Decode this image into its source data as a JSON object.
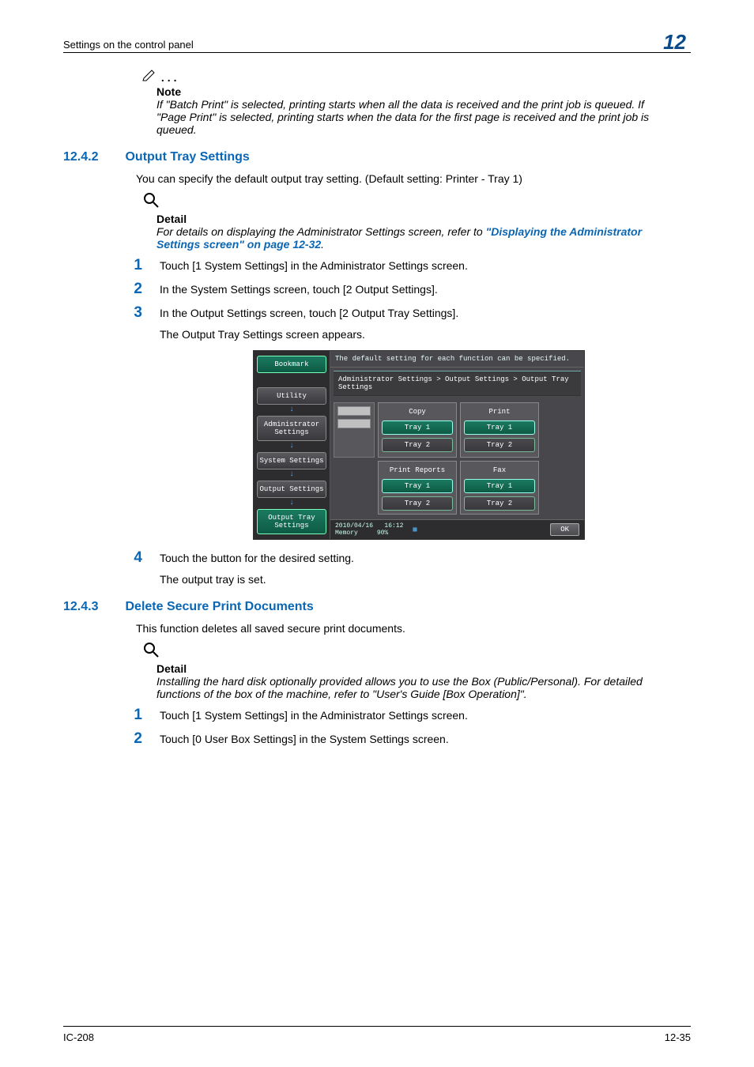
{
  "header": {
    "left": "Settings on the control panel",
    "chapter": "12"
  },
  "note1": {
    "label": "Note",
    "text": "If \"Batch Print\" is selected, printing starts when all the data is received and the print job is queued. If \"Page Print\" is selected, printing starts when the data for the first page is received and the print job is queued."
  },
  "sec1": {
    "number": "12.4.2",
    "title": "Output Tray Settings",
    "intro": "You can specify the default output tray setting. (Default setting: Printer - Tray 1)"
  },
  "detail1": {
    "label": "Detail",
    "pre": "For details on displaying the Administrator Settings screen, refer to ",
    "link": "\"Displaying the Administrator Settings screen\" on page 12-32",
    "post": "."
  },
  "steps1": [
    "Touch [1 System Settings] in the Administrator Settings screen.",
    "In the System Settings screen, touch [2 Output Settings].",
    "In the Output Settings screen, touch [2 Output Tray Settings]."
  ],
  "step1_sub": "The Output Tray Settings screen appears.",
  "step4": {
    "num": "4",
    "text": "Touch the button for the desired setting.",
    "sub": "The output tray is set."
  },
  "panel": {
    "hint": "The default setting for each function can be specified.",
    "breadcrumb": "Administrator Settings > Output Settings > Output Tray Settings",
    "sidebar": {
      "bookmark": "Bookmark",
      "utility": "Utility",
      "admin": "Administrator\nSettings",
      "system": "System Settings",
      "output": "Output Settings",
      "tray": "Output Tray\nSettings"
    },
    "cols": {
      "copy": {
        "header": "Copy",
        "tray1": "Tray 1",
        "tray2": "Tray 2"
      },
      "print": {
        "header": "Print",
        "tray1": "Tray 1",
        "tray2": "Tray 2"
      },
      "reports": {
        "header": "Print Reports",
        "tray1": "Tray 1",
        "tray2": "Tray 2"
      },
      "fax": {
        "header": "Fax",
        "tray1": "Tray 1",
        "tray2": "Tray 2"
      }
    },
    "footer": {
      "date": "2010/04/16",
      "time": "16:12",
      "mem_label": "Memory",
      "mem_val": "90%",
      "ok": "OK"
    }
  },
  "sec2": {
    "number": "12.4.3",
    "title": "Delete Secure Print Documents",
    "intro": "This function deletes all saved secure print documents."
  },
  "detail2": {
    "label": "Detail",
    "text": "Installing the hard disk optionally provided allows you to use the Box (Public/Personal). For detailed functions of the box of the machine, refer to \"User's Guide [Box Operation]\"."
  },
  "steps2": [
    "Touch [1 System Settings] in the Administrator Settings screen.",
    "Touch [0 User Box Settings] in the System Settings screen."
  ],
  "footer": {
    "left": "IC-208",
    "right": "12-35"
  }
}
